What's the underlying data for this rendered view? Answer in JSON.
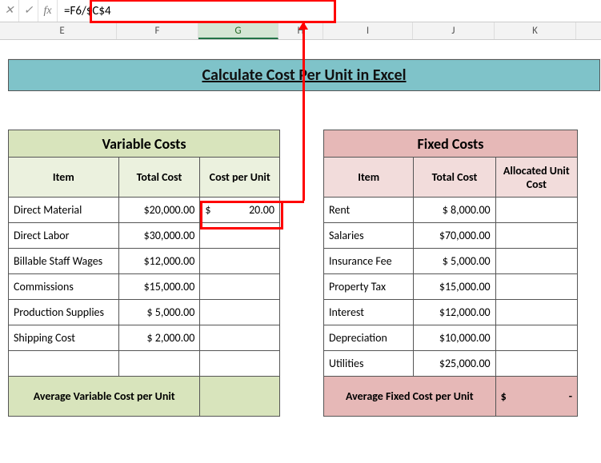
{
  "formula_bar": {
    "x": "✕",
    "check": "✓",
    "fx": "fx",
    "formula": "=F6/$C$4"
  },
  "columns": {
    "E": "E",
    "F": "F",
    "G": "G",
    "H": "H",
    "I": "I",
    "J": "J",
    "K": "K"
  },
  "title": "Calculate Cost Per Unit in Excel",
  "variable": {
    "header": "Variable Costs",
    "col_item": "Item",
    "col_total": "Total Cost",
    "col_cpu": "Cost per Unit",
    "rows": [
      {
        "item": "Direct Material",
        "total": "$20,000.00"
      },
      {
        "item": "Direct Labor",
        "total": "$30,000.00"
      },
      {
        "item": "Billable Staff Wages",
        "total": "$12,000.00"
      },
      {
        "item": "Commissions",
        "total": "$15,000.00"
      },
      {
        "item": "Production Supplies",
        "total": "$  5,000.00"
      },
      {
        "item": "Shipping Cost",
        "total": "$  2,000.00"
      }
    ],
    "cpu_first_prefix": "$",
    "cpu_first_value": "20.00",
    "avg_label": "Average Variable Cost per Unit"
  },
  "fixed": {
    "header": "Fixed Costs",
    "col_item": "Item",
    "col_total": "Total Cost",
    "col_alloc": "Allocated Unit Cost",
    "rows": [
      {
        "item": "Rent",
        "total": "$  8,000.00"
      },
      {
        "item": "Salaries",
        "total": "$70,000.00"
      },
      {
        "item": "Insurance Fee",
        "total": "$  5,000.00"
      },
      {
        "item": "Property Tax",
        "total": "$15,000.00"
      },
      {
        "item": "Interest",
        "total": "$12,000.00"
      },
      {
        "item": "Depreciation",
        "total": "$10,000.00"
      },
      {
        "item": "Utilities",
        "total": "$25,000.00"
      }
    ],
    "avg_label": "Average Fixed Cost per Unit",
    "avg_val_prefix": "$",
    "avg_val": "-"
  }
}
